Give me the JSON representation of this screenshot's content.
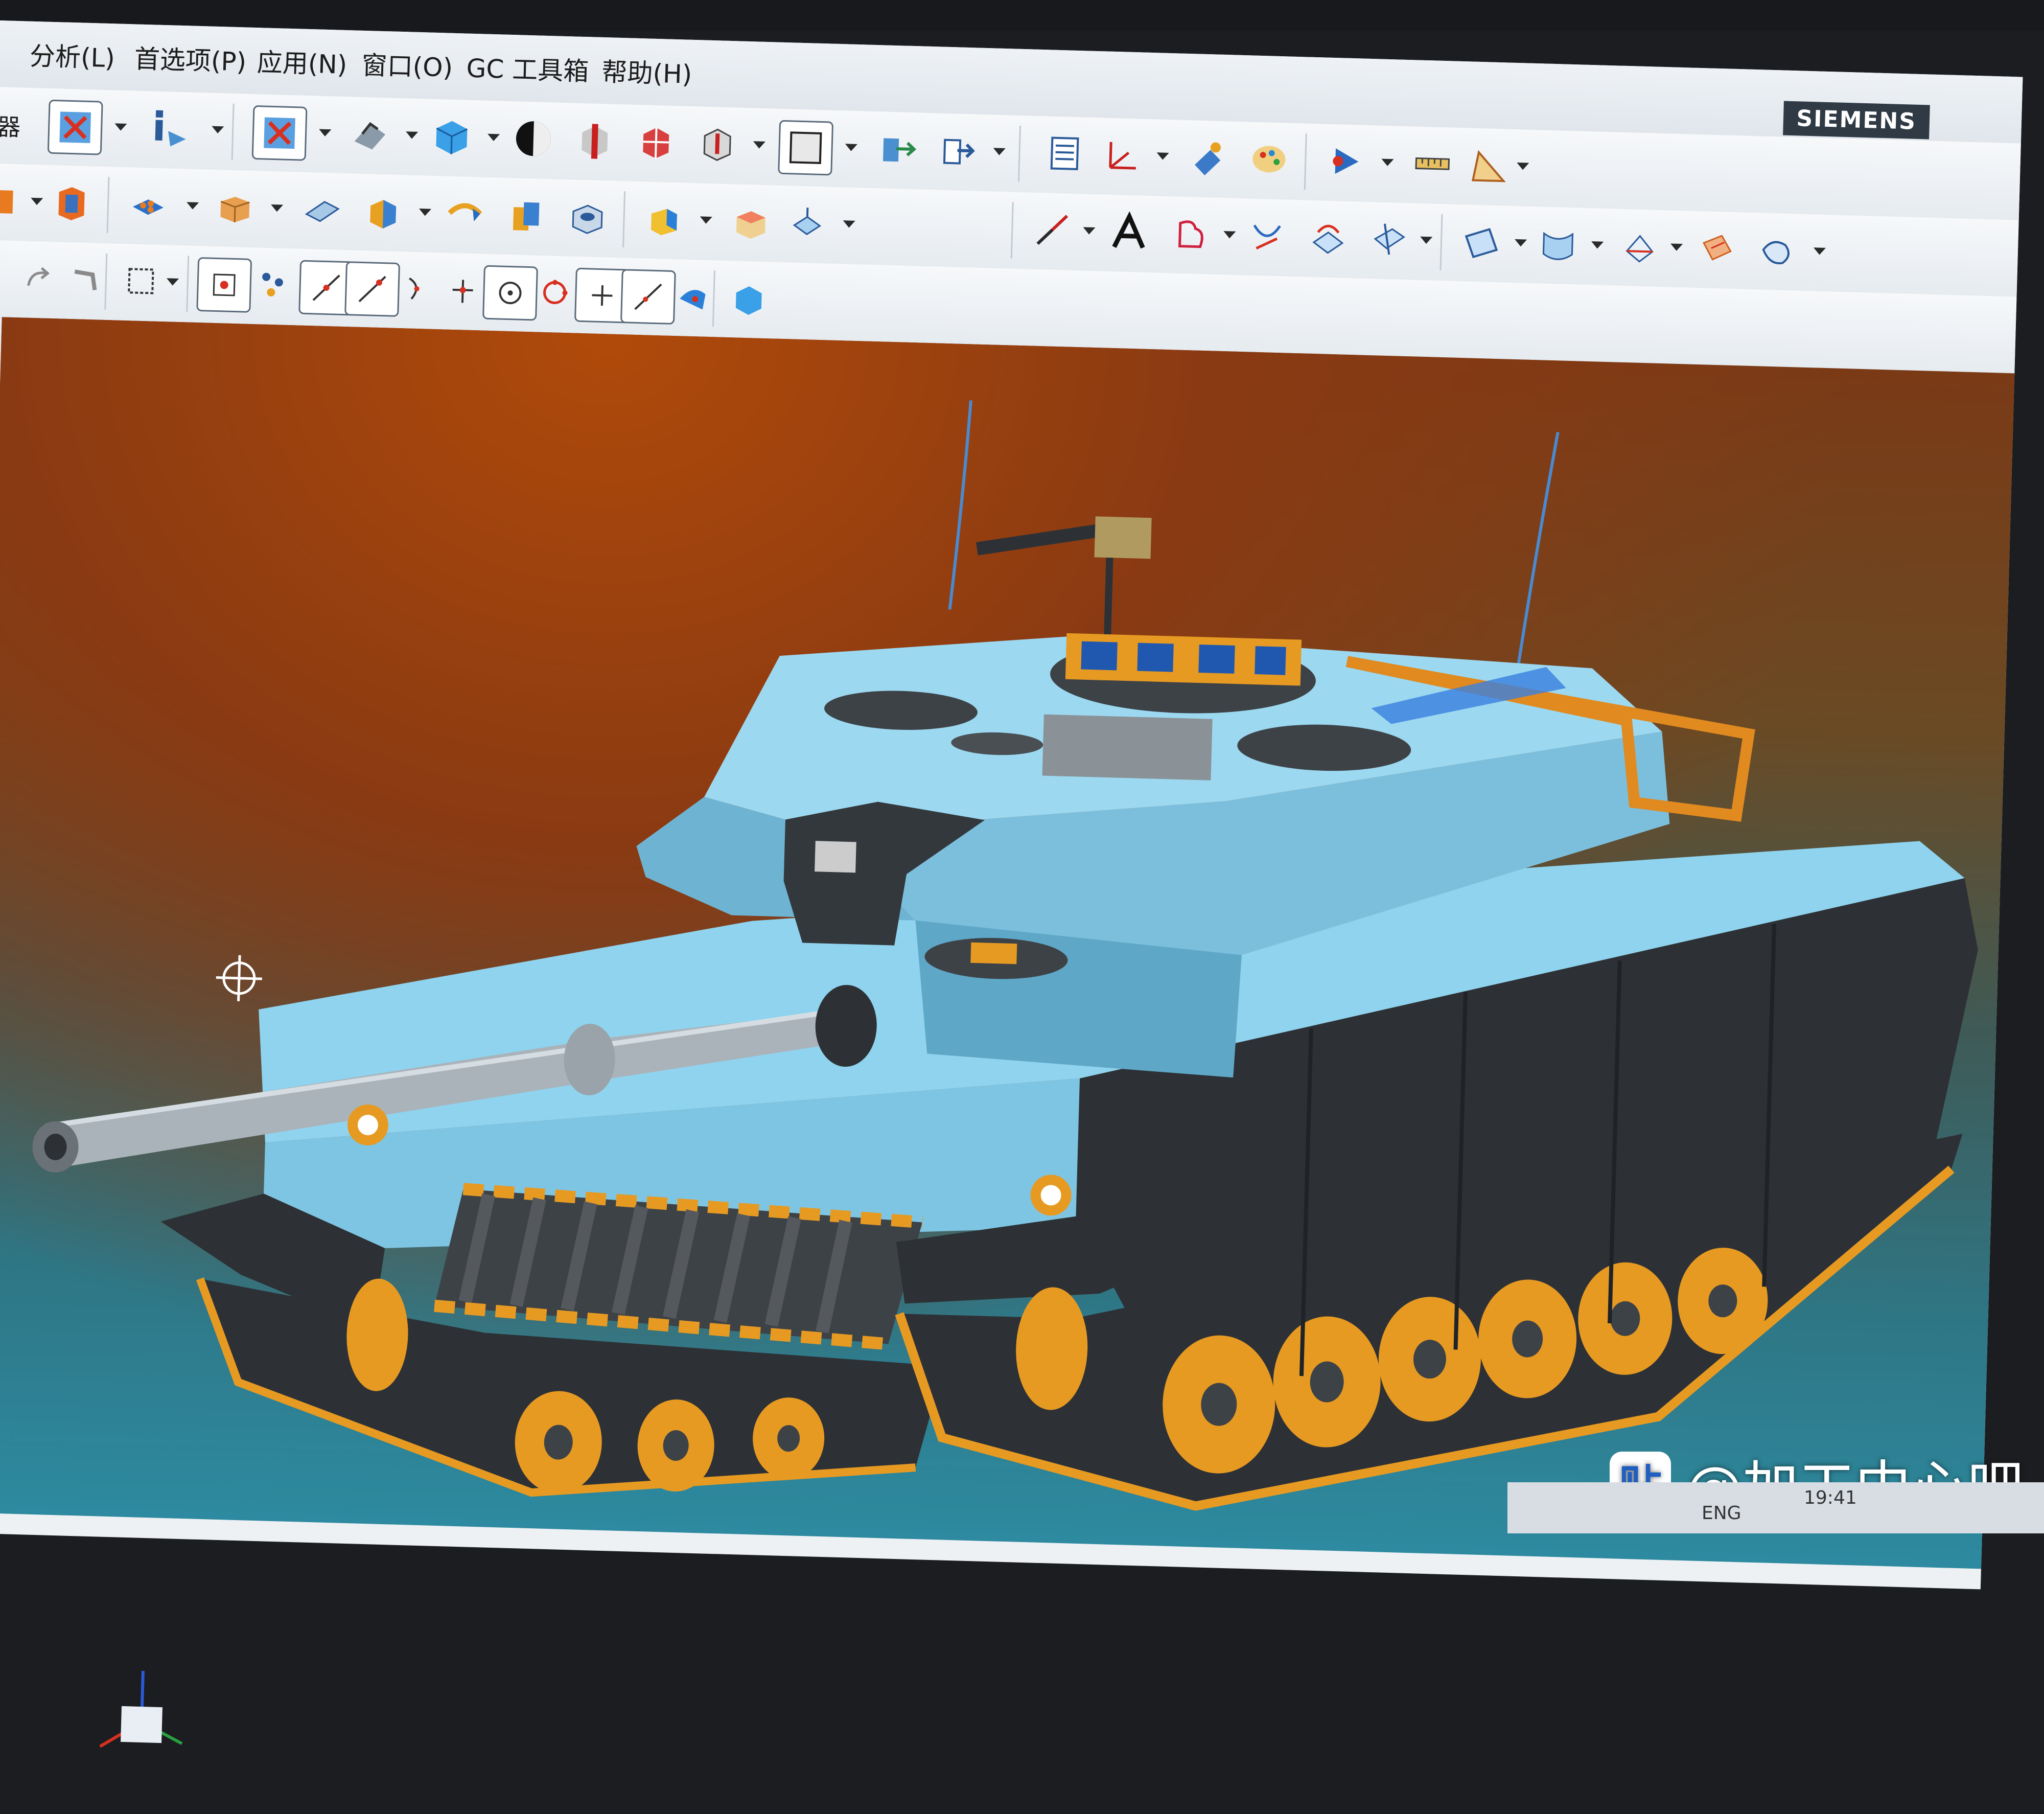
{
  "menu": {
    "items": [
      {
        "id": "analysis",
        "label": "分析(L)"
      },
      {
        "id": "preferences",
        "label": "首选项(P)"
      },
      {
        "id": "application",
        "label": "应用(N)"
      },
      {
        "id": "window",
        "label": "窗口(O)"
      },
      {
        "id": "gc-toolbox",
        "label": "GC 工具箱"
      },
      {
        "id": "help",
        "label": "帮助(H)"
      }
    ],
    "brand": "SIEMENS"
  },
  "toolbar": {
    "partial_label": "器"
  },
  "viewport": {
    "model": "tank"
  },
  "watermark": {
    "icon": "贴",
    "text": "@加工中心吧"
  },
  "taskbar": {
    "language": "ENG",
    "time": "19:41"
  },
  "colors": {
    "hull": "#8fd3ee",
    "hull_dark": "#2d3135",
    "wheel": "#e79a22",
    "bg_top": "#8a3a12",
    "bg_bottom": "#2d8aa0"
  }
}
